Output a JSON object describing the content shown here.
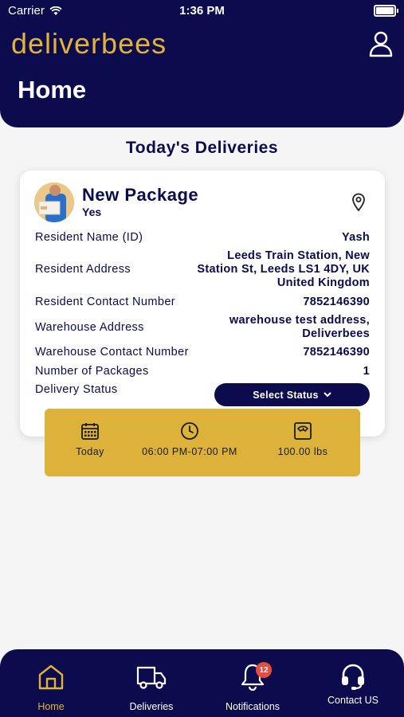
{
  "status_bar": {
    "carrier": "Carrier",
    "time": "1:36 PM"
  },
  "header": {
    "brand": "deliverbees",
    "title": "Home"
  },
  "section_title": "Today's Deliveries",
  "card": {
    "title": "New Package",
    "subtitle": "Yes",
    "rows": [
      {
        "label": "Resident Name (ID)",
        "value": "Yash"
      },
      {
        "label": "Resident Address",
        "value_lines": [
          "Leeds Train Station, New",
          "Station St, Leeds LS1 4DY, UK",
          "United Kingdom"
        ]
      },
      {
        "label": "Resident Contact Number",
        "value": "7852146390"
      },
      {
        "label": "Warehouse Address",
        "value_lines": [
          "warehouse test address,",
          "Deliverbees"
        ]
      },
      {
        "label": "Warehouse Contact Number",
        "value": "7852146390"
      },
      {
        "label": "Number of Packages",
        "value": "1"
      },
      {
        "label": "Delivery Status"
      }
    ],
    "select_status_label": "Select Status"
  },
  "info_bar": {
    "date": "Today",
    "time_window": "06:00 PM-07:00 PM",
    "weight": "100.00 lbs"
  },
  "tabs": [
    {
      "label": "Home",
      "icon": "home-icon",
      "active": true
    },
    {
      "label": "Deliveries",
      "icon": "truck-icon"
    },
    {
      "label": "Notifications",
      "icon": "bell-icon",
      "badge": "12"
    },
    {
      "label": "Contact US",
      "icon": "headset-icon"
    }
  ],
  "colors": {
    "navy": "#0b0b4d",
    "gold": "#e2b33a",
    "info_bar": "#dcb23a",
    "badge": "#e74c3c"
  }
}
